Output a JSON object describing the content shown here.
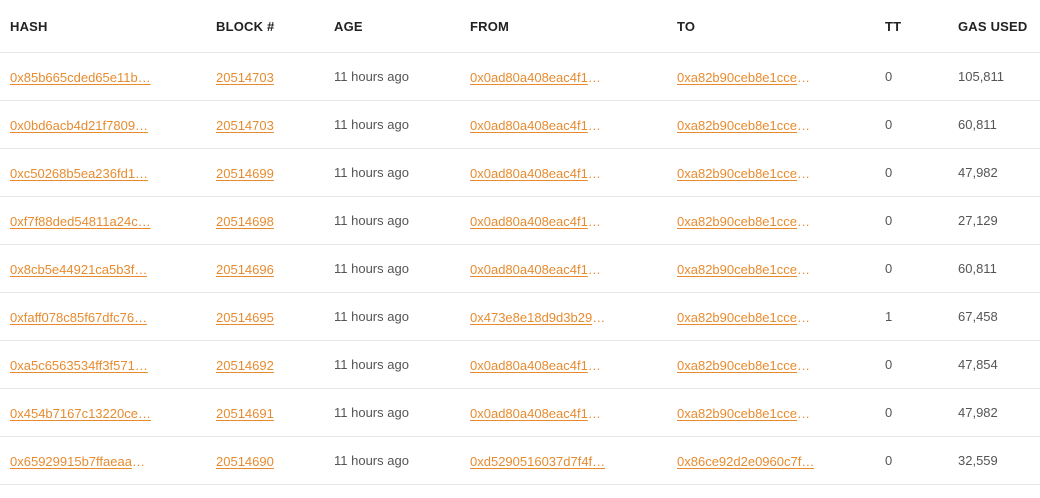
{
  "table": {
    "columns": [
      "HASH",
      "BLOCK #",
      "AGE",
      "FROM",
      "TO",
      "TT",
      "GAS USED"
    ],
    "rows": [
      {
        "hash": "0x85b665cded65e11b…",
        "block": "20514703",
        "age": "11 hours ago",
        "from": "0x0ad80a408eac4f17…",
        "to": "0xa82b90ceb8e1cce2…",
        "tt": "0",
        "gas": "105,811"
      },
      {
        "hash": "0x0bd6acb4d21f7809…",
        "block": "20514703",
        "age": "11 hours ago",
        "from": "0x0ad80a408eac4f17…",
        "to": "0xa82b90ceb8e1cce2…",
        "tt": "0",
        "gas": "60,811"
      },
      {
        "hash": "0xc50268b5ea236fd1…",
        "block": "20514699",
        "age": "11 hours ago",
        "from": "0x0ad80a408eac4f17…",
        "to": "0xa82b90ceb8e1cce2…",
        "tt": "0",
        "gas": "47,982"
      },
      {
        "hash": "0xf7f88ded54811a24c…",
        "block": "20514698",
        "age": "11 hours ago",
        "from": "0x0ad80a408eac4f17…",
        "to": "0xa82b90ceb8e1cce2…",
        "tt": "0",
        "gas": "27,129"
      },
      {
        "hash": "0x8cb5e44921ca5b3f…",
        "block": "20514696",
        "age": "11 hours ago",
        "from": "0x0ad80a408eac4f17…",
        "to": "0xa82b90ceb8e1cce2…",
        "tt": "0",
        "gas": "60,811"
      },
      {
        "hash": "0xfaff078c85f67dfc76…",
        "block": "20514695",
        "age": "11 hours ago",
        "from": "0x473e8e18d9d3b29e…",
        "to": "0xa82b90ceb8e1cce2…",
        "tt": "1",
        "gas": "67,458"
      },
      {
        "hash": "0xa5c6563534ff3f571…",
        "block": "20514692",
        "age": "11 hours ago",
        "from": "0x0ad80a408eac4f17…",
        "to": "0xa82b90ceb8e1cce2…",
        "tt": "0",
        "gas": "47,854"
      },
      {
        "hash": "0x454b7167c13220ce…",
        "block": "20514691",
        "age": "11 hours ago",
        "from": "0x0ad80a408eac4f17…",
        "to": "0xa82b90ceb8e1cce2…",
        "tt": "0",
        "gas": "47,982"
      },
      {
        "hash": "0x65929915b7ffaeaa0…",
        "block": "20514690",
        "age": "11 hours ago",
        "from": "0xd5290516037d7f4f…",
        "to": "0x86ce92d2e0960c7f…",
        "tt": "0",
        "gas": "32,559"
      }
    ]
  },
  "colors": {
    "link": "#e88b2e",
    "divider": "#e6e6e6",
    "text": "#333333"
  }
}
